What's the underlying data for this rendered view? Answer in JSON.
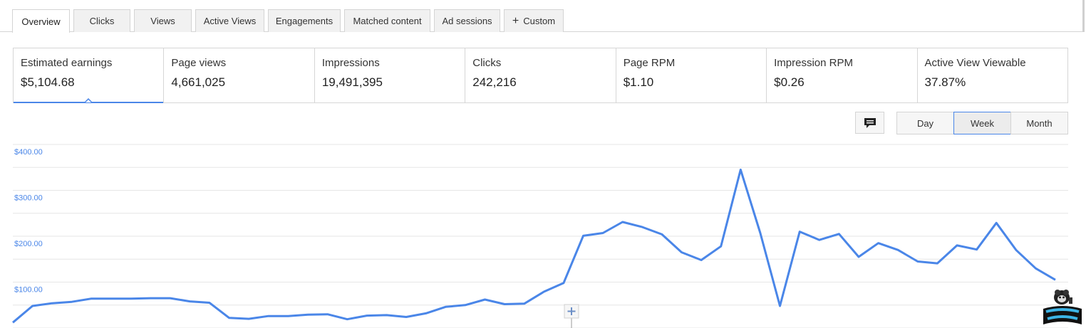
{
  "tabs": [
    {
      "label": "Overview",
      "active": true
    },
    {
      "label": "Clicks"
    },
    {
      "label": "Views"
    },
    {
      "label": "Active Views"
    },
    {
      "label": "Engagements"
    },
    {
      "label": "Matched content"
    },
    {
      "label": "Ad sessions"
    },
    {
      "label": "Custom",
      "icon": "plus-icon"
    }
  ],
  "metrics": [
    {
      "label": "Estimated earnings",
      "value": "$5,104.68",
      "selected": true
    },
    {
      "label": "Page views",
      "value": "4,661,025"
    },
    {
      "label": "Impressions",
      "value": "19,491,395"
    },
    {
      "label": "Clicks",
      "value": "242,216"
    },
    {
      "label": "Page RPM",
      "value": "$1.10"
    },
    {
      "label": "Impression RPM",
      "value": "$0.26"
    },
    {
      "label": "Active View Viewable",
      "value": "37.87%"
    }
  ],
  "controls": {
    "comment_icon": "comment-icon",
    "granularity": [
      {
        "label": "Day"
      },
      {
        "label": "Week",
        "active": true
      },
      {
        "label": "Month"
      }
    ]
  },
  "logo": {
    "text": "one smart sheep"
  },
  "colors": {
    "accent": "#4a86e8",
    "grid": "#e6e6e6"
  },
  "chart_data": {
    "type": "line",
    "title": "",
    "xlabel": "",
    "ylabel": "",
    "grid": true,
    "ylim": [
      0,
      400
    ],
    "yticks": [
      {
        "value": 400,
        "label": "$400.00"
      },
      {
        "value": 300,
        "label": "$300.00"
      },
      {
        "value": 200,
        "label": "$200.00"
      },
      {
        "value": 100,
        "label": "$100.00"
      }
    ],
    "series": [
      {
        "color": "#4a86e8",
        "values": [
          12,
          48,
          54,
          57,
          64,
          64,
          64,
          65,
          65,
          58,
          55,
          22,
          20,
          26,
          26,
          29,
          30,
          19,
          27,
          28,
          24,
          32,
          46,
          50,
          62,
          52,
          53,
          79,
          98,
          201,
          207,
          231,
          220,
          204,
          165,
          148,
          178,
          345,
          207,
          48,
          210,
          192,
          205,
          155,
          185,
          170,
          145,
          141,
          180,
          171,
          229,
          170,
          130,
          105
        ]
      }
    ]
  }
}
